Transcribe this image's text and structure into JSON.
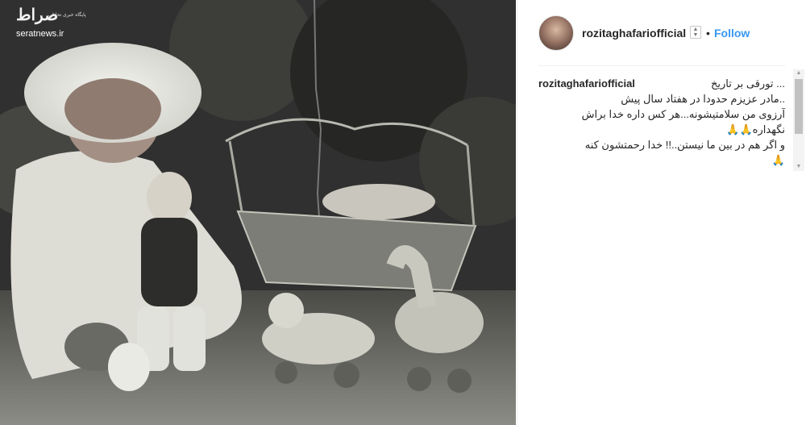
{
  "watermark": {
    "logo_text": "صراط",
    "tagline": "پایگاه خبری تحلیلی",
    "site": "seratnews.ir"
  },
  "post": {
    "username": "rozitaghafariofficial",
    "separator": "•",
    "follow_label": "Follow",
    "caption": {
      "username": "rozitaghafariofficial",
      "lines": [
        "... تورقی بر تاریخ",
        "..مادر عزیزم حدودا در هفتاد سال پیش",
        "آرزوی من سلامتیشونه...هر کس داره خدا براش",
        "نگهداره🙏🙏",
        "و اگر هم در بین ما نیستن..!! خدا رحمتشون کنه",
        "🙏"
      ]
    }
  },
  "icons": {
    "sort": "sort-arrows-icon",
    "scroll_up": "triangle-up-icon",
    "scroll_down": "triangle-down-icon"
  }
}
